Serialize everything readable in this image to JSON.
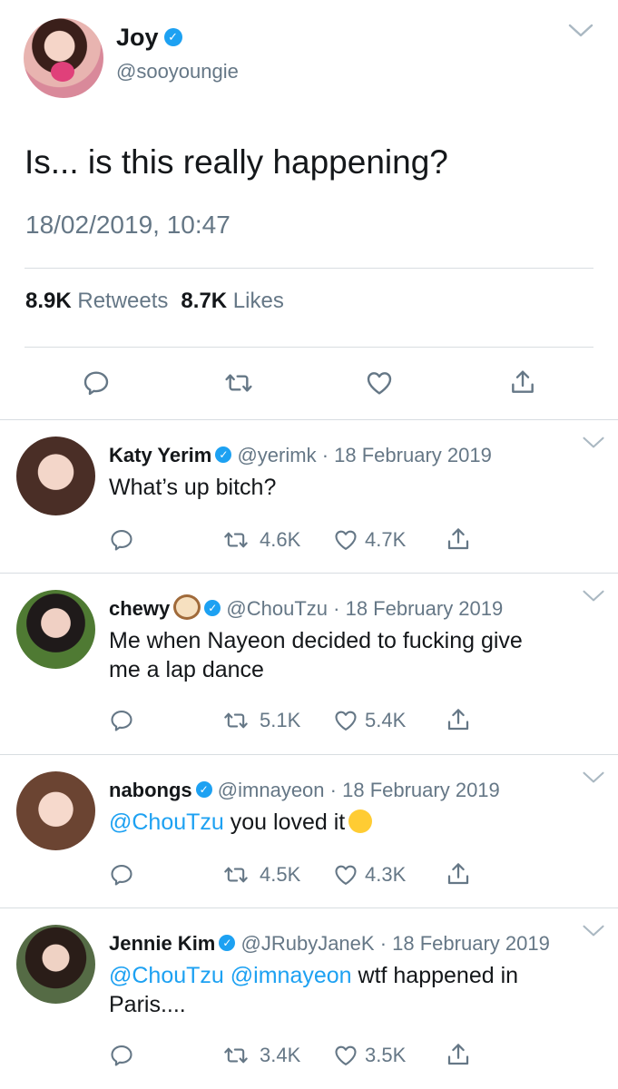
{
  "main_tweet": {
    "author_name": "Joy",
    "handle": "@sooyoungie",
    "text": "Is... is this really happening?",
    "timestamp": "18/02/2019, 10:47",
    "retweets_count": "8.9K",
    "retweets_label": "Retweets",
    "likes_count": "8.7K",
    "likes_label": "Likes"
  },
  "replies": [
    {
      "name": "Katy Yerim",
      "handle": "@yerimk",
      "date": "18 February 2019",
      "text": "What’s up bitch?",
      "retweets": "4.6K",
      "likes": "4.7K"
    },
    {
      "name": "chewy",
      "handle": "@ChouTzu",
      "date": "18 February 2019",
      "text_line1": "Me when Nayeon decided to fucking give",
      "text_line2": "me a lap dance",
      "retweets": "5.1K",
      "likes": "5.4K"
    },
    {
      "name": "nabongs",
      "handle": "@imnayeon",
      "date": "18 February 2019",
      "mention": "@ChouTzu",
      "text": "you loved it",
      "retweets": "4.5K",
      "likes": "4.3K"
    },
    {
      "name": "Jennie Kim",
      "handle": "@JRubyJaneK",
      "date": "18 February 2019",
      "mention1": "@ChouTzu",
      "mention2": "@imnayeon",
      "text_line1": "wtf happened in",
      "text_line2": "Paris....",
      "retweets": "3.4K",
      "likes": "3.5K"
    }
  ],
  "separator": "·",
  "colors": {
    "accent": "#1da1f2",
    "secondary_text": "#657786",
    "divider": "#d8dde1"
  },
  "icons": [
    "verified-badge",
    "chevron-down",
    "reply-icon",
    "retweet-icon",
    "like-icon",
    "share-icon"
  ]
}
